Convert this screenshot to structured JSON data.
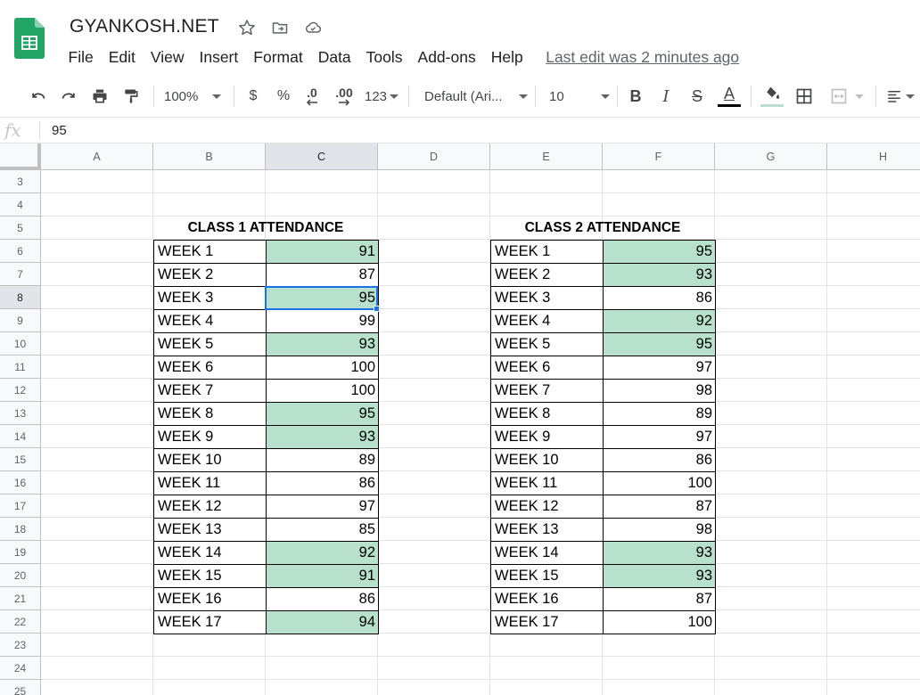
{
  "app": {
    "doc_title": "GYANKOSH.NET",
    "menu": [
      "File",
      "Edit",
      "View",
      "Insert",
      "Format",
      "Data",
      "Tools",
      "Add-ons",
      "Help"
    ],
    "last_edit": "Last edit was 2 minutes ago"
  },
  "toolbar": {
    "zoom": "100%",
    "currency": "$",
    "percent": "%",
    "decrease_decimal": ".0",
    "increase_decimal": ".00",
    "more_formats": "123",
    "font": "Default (Ari...",
    "font_size": "10",
    "bold": "B",
    "italic": "I",
    "strike": "S",
    "text_color": "A"
  },
  "formula_bar": {
    "fx": "fx",
    "value": "95"
  },
  "grid": {
    "columns": [
      "A",
      "B",
      "C",
      "D",
      "E",
      "F",
      "G",
      "H"
    ],
    "rows": [
      "3",
      "4",
      "5",
      "6",
      "7",
      "8",
      "9",
      "10",
      "11",
      "12",
      "13",
      "14",
      "15",
      "16",
      "17",
      "18",
      "19",
      "20",
      "21",
      "22",
      "23",
      "24",
      "25"
    ],
    "active_column": "C",
    "active_row": "8",
    "highlight_color": "#b7e1cd"
  },
  "class1": {
    "title": "CLASS 1 ATTENDANCE",
    "rows": [
      {
        "label": "WEEK 1",
        "value": "91",
        "highlight": true
      },
      {
        "label": "WEEK 2",
        "value": "87",
        "highlight": false
      },
      {
        "label": "WEEK 3",
        "value": "95",
        "highlight": true
      },
      {
        "label": "WEEK 4",
        "value": "99",
        "highlight": false
      },
      {
        "label": "WEEK 5",
        "value": "93",
        "highlight": true
      },
      {
        "label": "WEEK 6",
        "value": "100",
        "highlight": false
      },
      {
        "label": "WEEK 7",
        "value": "100",
        "highlight": false
      },
      {
        "label": "WEEK 8",
        "value": "95",
        "highlight": true
      },
      {
        "label": "WEEK 9",
        "value": "93",
        "highlight": true
      },
      {
        "label": "WEEK 10",
        "value": "89",
        "highlight": false
      },
      {
        "label": "WEEK 11",
        "value": "86",
        "highlight": false
      },
      {
        "label": "WEEK 12",
        "value": "97",
        "highlight": false
      },
      {
        "label": "WEEK 13",
        "value": "85",
        "highlight": false
      },
      {
        "label": "WEEK 14",
        "value": "92",
        "highlight": true
      },
      {
        "label": "WEEK 15",
        "value": "91",
        "highlight": true
      },
      {
        "label": "WEEK 16",
        "value": "86",
        "highlight": false
      },
      {
        "label": "WEEK 17",
        "value": "94",
        "highlight": true
      }
    ]
  },
  "class2": {
    "title": "CLASS 2 ATTENDANCE",
    "rows": [
      {
        "label": "WEEK 1",
        "value": "95",
        "highlight": true
      },
      {
        "label": "WEEK 2",
        "value": "93",
        "highlight": true
      },
      {
        "label": "WEEK 3",
        "value": "86",
        "highlight": false
      },
      {
        "label": "WEEK 4",
        "value": "92",
        "highlight": true
      },
      {
        "label": "WEEK 5",
        "value": "95",
        "highlight": true
      },
      {
        "label": "WEEK 6",
        "value": "97",
        "highlight": false
      },
      {
        "label": "WEEK 7",
        "value": "98",
        "highlight": false
      },
      {
        "label": "WEEK 8",
        "value": "89",
        "highlight": false
      },
      {
        "label": "WEEK 9",
        "value": "97",
        "highlight": false
      },
      {
        "label": "WEEK 10",
        "value": "86",
        "highlight": false
      },
      {
        "label": "WEEK 11",
        "value": "100",
        "highlight": false
      },
      {
        "label": "WEEK 12",
        "value": "87",
        "highlight": false
      },
      {
        "label": "WEEK 13",
        "value": "98",
        "highlight": false
      },
      {
        "label": "WEEK 14",
        "value": "93",
        "highlight": true
      },
      {
        "label": "WEEK 15",
        "value": "93",
        "highlight": true
      },
      {
        "label": "WEEK 16",
        "value": "87",
        "highlight": false
      },
      {
        "label": "WEEK 17",
        "value": "100",
        "highlight": false
      }
    ]
  }
}
